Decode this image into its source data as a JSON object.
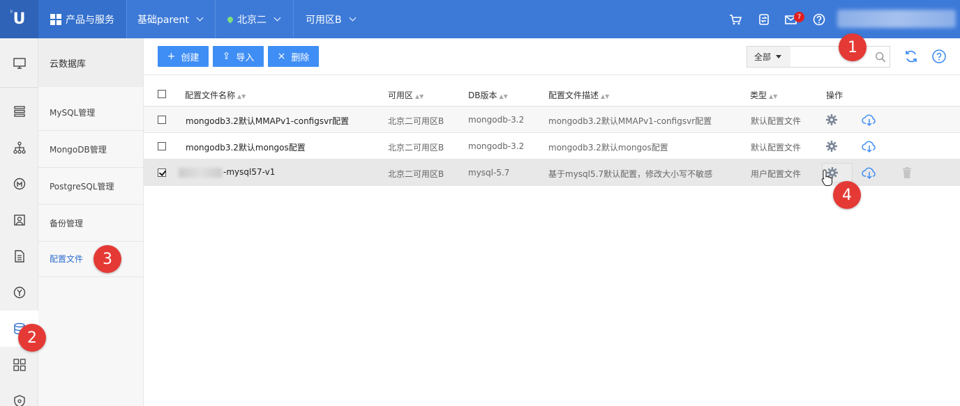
{
  "topbar": {
    "products": "产品与服务",
    "project": "基础parent",
    "region": "北京二",
    "zone": "可用区B",
    "mail_badge": "7"
  },
  "submenu": {
    "title": "云数据库",
    "items": [
      "MySQL管理",
      "MongoDB管理",
      "PostgreSQL管理",
      "备份管理",
      "配置文件"
    ]
  },
  "toolbar": {
    "create": "创建",
    "import": "导入",
    "delete": "删除",
    "filter_selected": "全部",
    "search_placeholder": ""
  },
  "table": {
    "headers": [
      "配置文件名称",
      "可用区",
      "DB版本",
      "配置文件描述",
      "类型",
      "操作"
    ],
    "rows": [
      {
        "name": "mongodb3.2默认MMAPv1-configsvr配置",
        "zone": "北京二可用区B",
        "version": "mongodb-3.2",
        "desc": "mongodb3.2默认MMAPv1-configsvr配置",
        "type": "默认配置文件",
        "checked": false
      },
      {
        "name": "mongodb3.2默认mongos配置",
        "zone": "北京二可用区B",
        "version": "mongodb-3.2",
        "desc": "mongodb3.2默认mongos配置",
        "type": "默认配置文件",
        "checked": false
      },
      {
        "name": "-mysql57-v1",
        "zone": "北京二可用区B",
        "version": "mysql-5.7",
        "desc": "基于mysql5.7默认配置，修改大小写不敏感",
        "type": "用户配置文件",
        "checked": true
      }
    ]
  },
  "markers": [
    "1",
    "2",
    "3",
    "4"
  ],
  "colors": {
    "topbar": "#3d7ad8",
    "primary_button": "#3f8ef5",
    "active_link": "#2f6fd0",
    "marker": "#e53935"
  }
}
